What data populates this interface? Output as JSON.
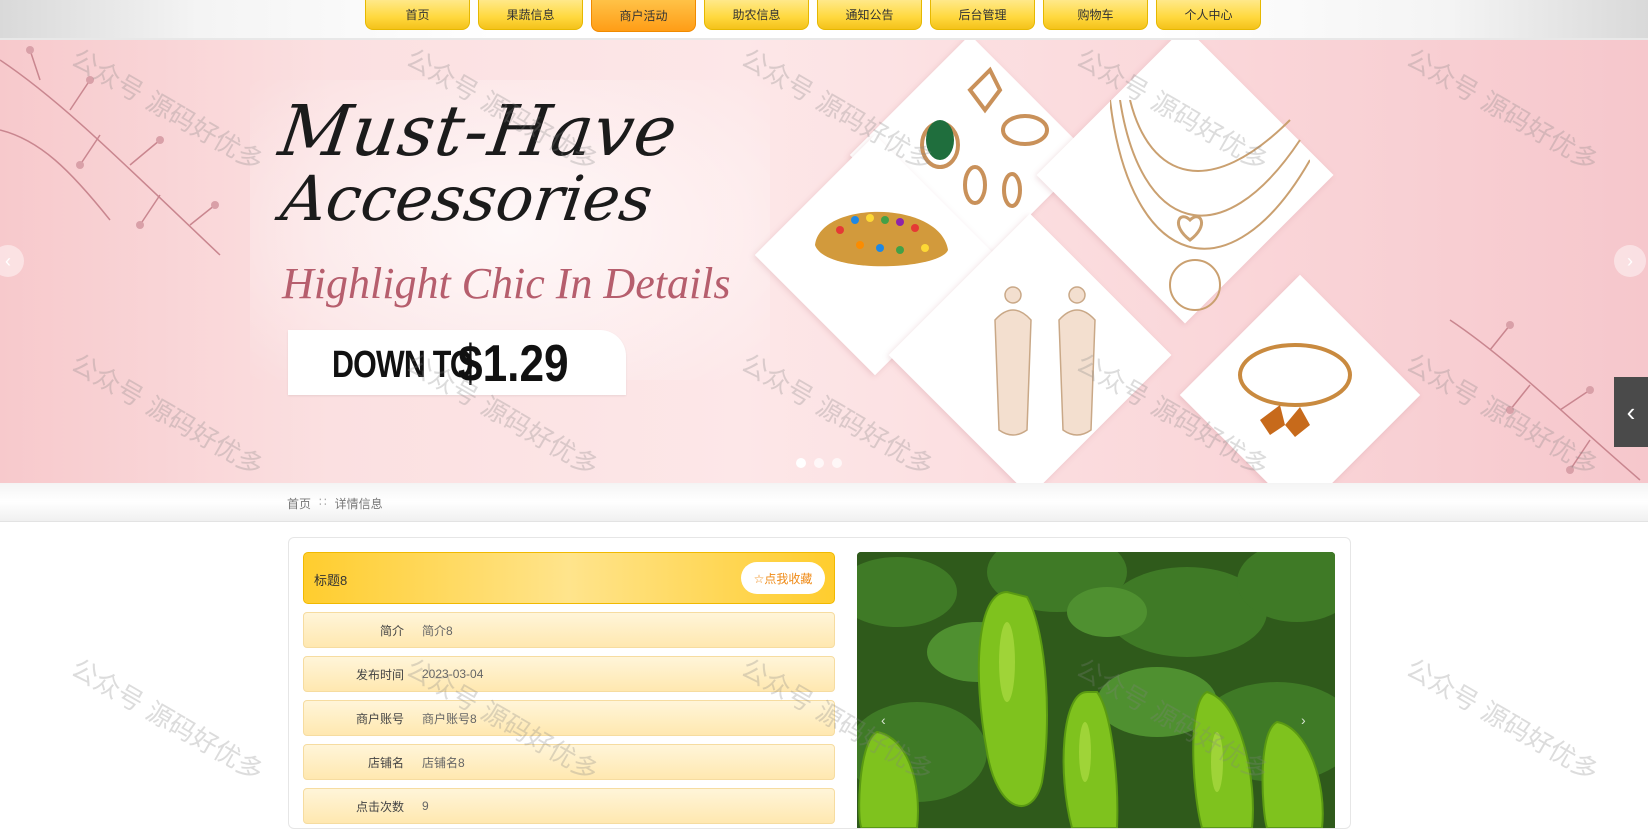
{
  "nav": {
    "items": [
      "首页",
      "果蔬信息",
      "商户活动",
      "助农信息",
      "通知公告",
      "后台管理",
      "购物车",
      "个人中心"
    ],
    "active_index": 2
  },
  "banner": {
    "line1": "Must-Have",
    "line2": "Accessories",
    "tagline": "Highlight Chic In Details",
    "price_prefix": "DOWN TO",
    "price": "$1.29",
    "prev_icon": "‹",
    "next_icon": "›",
    "side_tab_icon": "‹",
    "slide_count": 3,
    "active_slide": 0
  },
  "breadcrumb": {
    "home": "首页",
    "separator": "∷",
    "current": "详情信息"
  },
  "detail": {
    "title": "标题8",
    "favorite_label": "☆点我收藏",
    "fields": [
      {
        "label": "简介",
        "value": "简介8"
      },
      {
        "label": "发布时间",
        "value": "2023-03-04"
      },
      {
        "label": "商户账号",
        "value": "商户账号8"
      },
      {
        "label": "店铺名",
        "value": "店铺名8"
      },
      {
        "label": "点击次数",
        "value": "9"
      }
    ],
    "photo_prev": "‹",
    "photo_next": "›"
  },
  "watermark": "公众号 源码好优多",
  "colors": {
    "nav_yellow": "#ffd83d",
    "nav_active": "#ff9d16",
    "banner_pink": "#fbe0e1",
    "title_yellow": "#ffcd2e",
    "favorite_text": "#ef8a16"
  }
}
